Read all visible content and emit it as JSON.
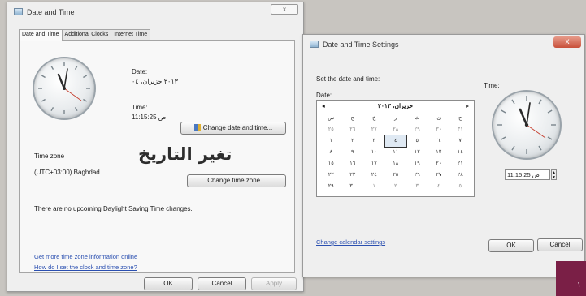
{
  "dlg1": {
    "title": "Date and Time",
    "close_label": "x",
    "tabs": [
      "Date and Time",
      "Additional Clocks",
      "Internet Time"
    ],
    "date_label": "Date:",
    "date_value": "٢٠١٣ حزيران، ٠٤",
    "time_label": "Time:",
    "time_value": "11:15:25 ص",
    "change_datetime_btn": "Change date and time...",
    "timezone_label": "Time zone",
    "timezone_value": "(UTC+03:00) Baghdad",
    "change_tz_btn": "Change time zone...",
    "dst_text": "There are no upcoming Daylight Saving Time changes.",
    "link1": "Get more time zone information online",
    "link2": "How do I set the clock and time zone?",
    "ok": "OK",
    "cancel": "Cancel",
    "apply": "Apply",
    "annotation": "تغير التاريخ"
  },
  "dlg2": {
    "title": "Date and Time Settings",
    "close_label": "x",
    "instruction": "Set the date and time:",
    "date_label": "Date:",
    "time_label": "Time:",
    "month_title": "حزيران، ٢٠١٣",
    "prev": "◂",
    "next": "▸",
    "calendar_rows": [
      [
        "س",
        "ج",
        "خ",
        "ر",
        "ث",
        "ن",
        "ح"
      ],
      [
        "٢٥",
        "٢٦",
        "٢٧",
        "٢٨",
        "٢٩",
        "٣٠",
        "٣١"
      ],
      [
        "١",
        "٢",
        "٣",
        "٤",
        "٥",
        "٦",
        "٧"
      ],
      [
        "٨",
        "٩",
        "١٠",
        "١١",
        "١٢",
        "١٣",
        "١٤"
      ],
      [
        "١٥",
        "١٦",
        "١٧",
        "١٨",
        "١٩",
        "٢٠",
        "٢١"
      ],
      [
        "٢٢",
        "٢٣",
        "٢٤",
        "٢٥",
        "٢٦",
        "٢٧",
        "٢٨"
      ],
      [
        "٢٩",
        "٣٠",
        "١",
        "٢",
        "٣",
        "٤",
        "٥"
      ]
    ],
    "time_value": "11:15:25 ص",
    "change_cal_link": "Change calendar settings",
    "ok": "OK",
    "cancel": "Cancel"
  },
  "corner_text": "١"
}
